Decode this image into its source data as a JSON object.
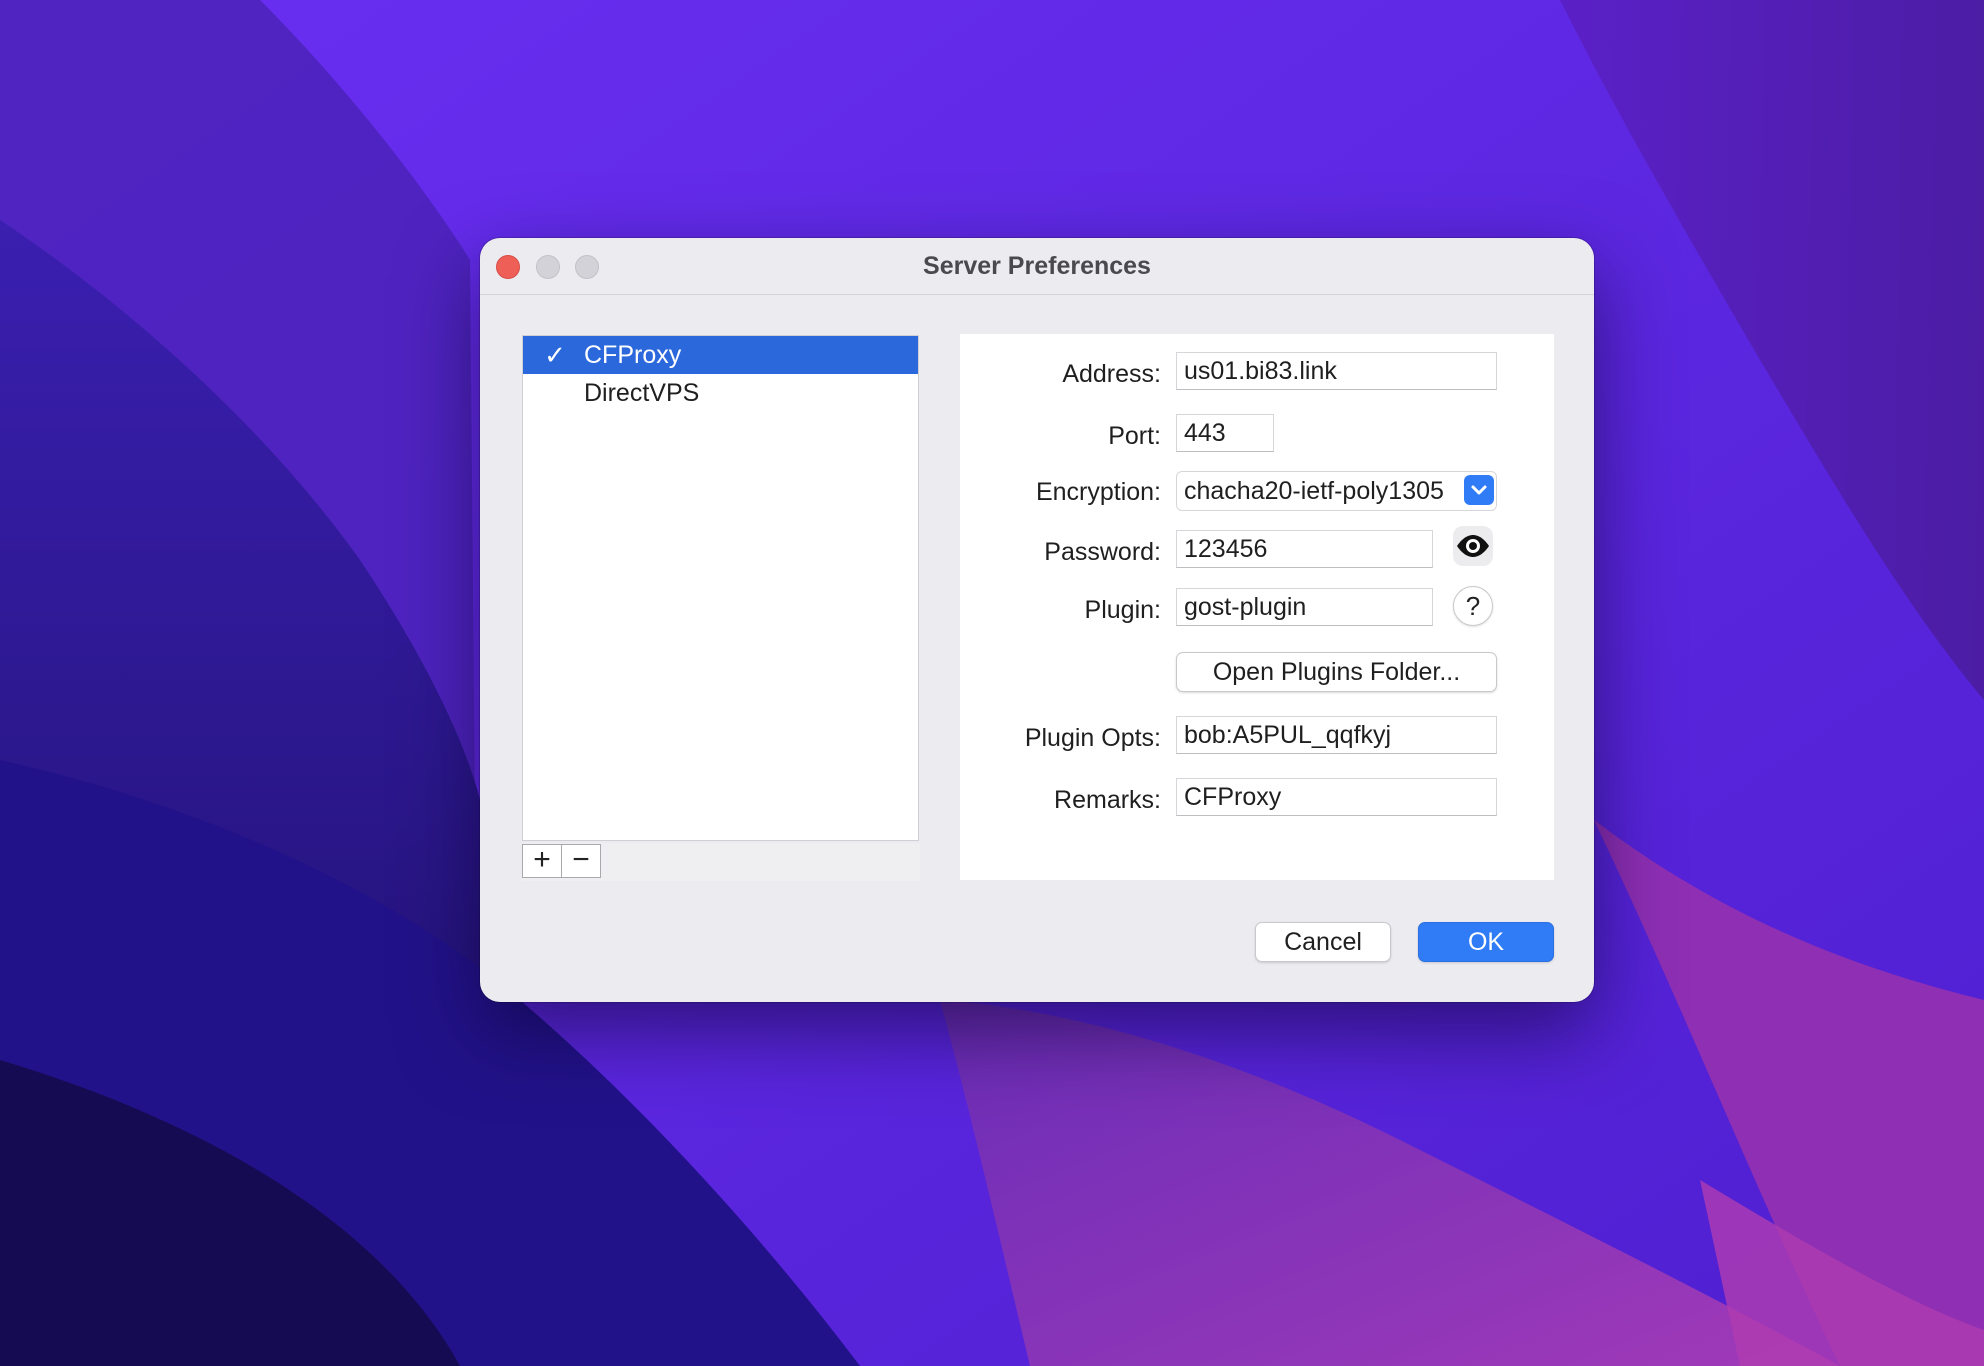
{
  "window": {
    "title": "Server Preferences"
  },
  "servers": [
    {
      "label": "CFProxy",
      "check": "✓",
      "selected": true
    },
    {
      "label": "DirectVPS",
      "check": "",
      "selected": false
    }
  ],
  "list_controls": {
    "add_label": "+",
    "remove_label": "−"
  },
  "form": {
    "address_label": "Address:",
    "address_value": "us01.bi83.link",
    "port_label": "Port:",
    "port_value": "443",
    "encryption_label": "Encryption:",
    "encryption_value": "chacha20-ietf-poly1305",
    "password_label": "Password:",
    "password_value": "123456",
    "plugin_label": "Plugin:",
    "plugin_value": "gost-plugin",
    "help_label": "?",
    "open_plugins_label": "Open Plugins Folder...",
    "plugin_opts_label": "Plugin Opts:",
    "plugin_opts_value": "bob:A5PUL_qqfkyj",
    "remarks_label": "Remarks:",
    "remarks_value": "CFProxy"
  },
  "actions": {
    "cancel_label": "Cancel",
    "ok_label": "OK"
  },
  "colors": {
    "accent": "#2f7cf6",
    "selection": "#2a68dc",
    "close": "#ee5f57"
  },
  "icons": {
    "password_toggle": "eye-icon",
    "encryption_dropdown": "chevron-down-icon"
  }
}
